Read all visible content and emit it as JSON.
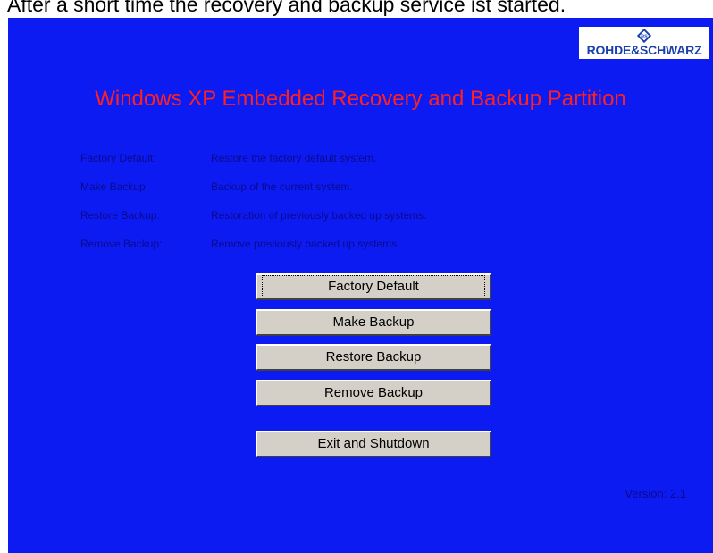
{
  "caption": "After a short time the recovery and backup service ist started.",
  "logo": {
    "text": "ROHDE&SCHWARZ"
  },
  "title": "Windows XP Embedded Recovery and Backup Partition",
  "descriptions": [
    {
      "label": "Factory Default:",
      "text": "Restore the factory default system."
    },
    {
      "label": "Make Backup:",
      "text": "Backup of the current system."
    },
    {
      "label": "Restore Backup:",
      "text": "Restoration of previously backed up systems."
    },
    {
      "label": "Remove Backup:",
      "text": "Remove previously backed up systems."
    }
  ],
  "buttons": {
    "factory_default": "Factory Default",
    "make_backup": "Make Backup",
    "restore_backup": "Restore Backup",
    "remove_backup": "Remove Backup",
    "exit_shutdown": "Exit and Shutdown"
  },
  "version": "Version: 2.1",
  "colors": {
    "background": "#0d1bf3",
    "title": "#ff2020",
    "description_text": "#0a0a8a",
    "button_face": "#d4d0c8"
  }
}
